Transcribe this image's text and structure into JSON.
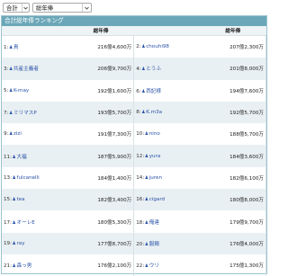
{
  "filters": {
    "scope": "合計",
    "metric": "総年俸"
  },
  "ranking": {
    "title": "合計総年俸ランキング",
    "column_header": "総年俸",
    "rows": [
      [
        {
          "rank": "1",
          "name": "鳥",
          "amount": "216億4,600万"
        },
        {
          "rank": "2",
          "name": "chouhi98",
          "amount": "207億2,300万"
        }
      ],
      [
        {
          "rank": "3",
          "name": "共産主義者",
          "amount": "206億9,700万"
        },
        {
          "rank": "4",
          "name": "とうふ",
          "amount": "201億8,000万"
        }
      ],
      [
        {
          "rank": "5",
          "name": "K-may",
          "amount": "192億1,600万"
        },
        {
          "rank": "6",
          "name": "西記様",
          "amount": "194億7,600万"
        }
      ],
      [
        {
          "rank": "7",
          "name": "ミリマスP",
          "amount": "193億5,700万"
        },
        {
          "rank": "8",
          "name": "K.m3a",
          "amount": "192億5,700万"
        }
      ],
      [
        {
          "rank": "9",
          "name": "zizi",
          "amount": "191億7,300万"
        },
        {
          "rank": "10",
          "name": "nino",
          "amount": "188億5,700万"
        }
      ],
      [
        {
          "rank": "11",
          "name": "大福",
          "amount": "187億5,900万"
        },
        {
          "rank": "12",
          "name": "yura",
          "amount": "184億3,600万"
        }
      ],
      [
        {
          "rank": "13",
          "name": "fulcanelli",
          "amount": "184億1,400万"
        },
        {
          "rank": "14",
          "name": "juren",
          "amount": "182億6,100万"
        }
      ],
      [
        {
          "rank": "15",
          "name": "tea",
          "amount": "182億3,400万"
        },
        {
          "rank": "16",
          "name": "cigard",
          "amount": "180億8,000万"
        }
      ],
      [
        {
          "rank": "17",
          "name": "オーレE",
          "amount": "180億5,300万"
        },
        {
          "rank": "18",
          "name": "俺達",
          "amount": "179億9,700万"
        }
      ],
      [
        {
          "rank": "19",
          "name": "ray",
          "amount": "177億8,700万"
        },
        {
          "rank": "20",
          "name": "服鶏",
          "amount": "176億4,000万"
        }
      ],
      [
        {
          "rank": "21",
          "name": "森っ男",
          "amount": "176億2,100万"
        },
        {
          "rank": "22",
          "name": "ウリ",
          "amount": "175億1,300万"
        }
      ]
    ]
  },
  "colors": {
    "header_bar": "#6ba7b8",
    "row_alt": "#e9f0f3",
    "link": "#2a52a8"
  }
}
